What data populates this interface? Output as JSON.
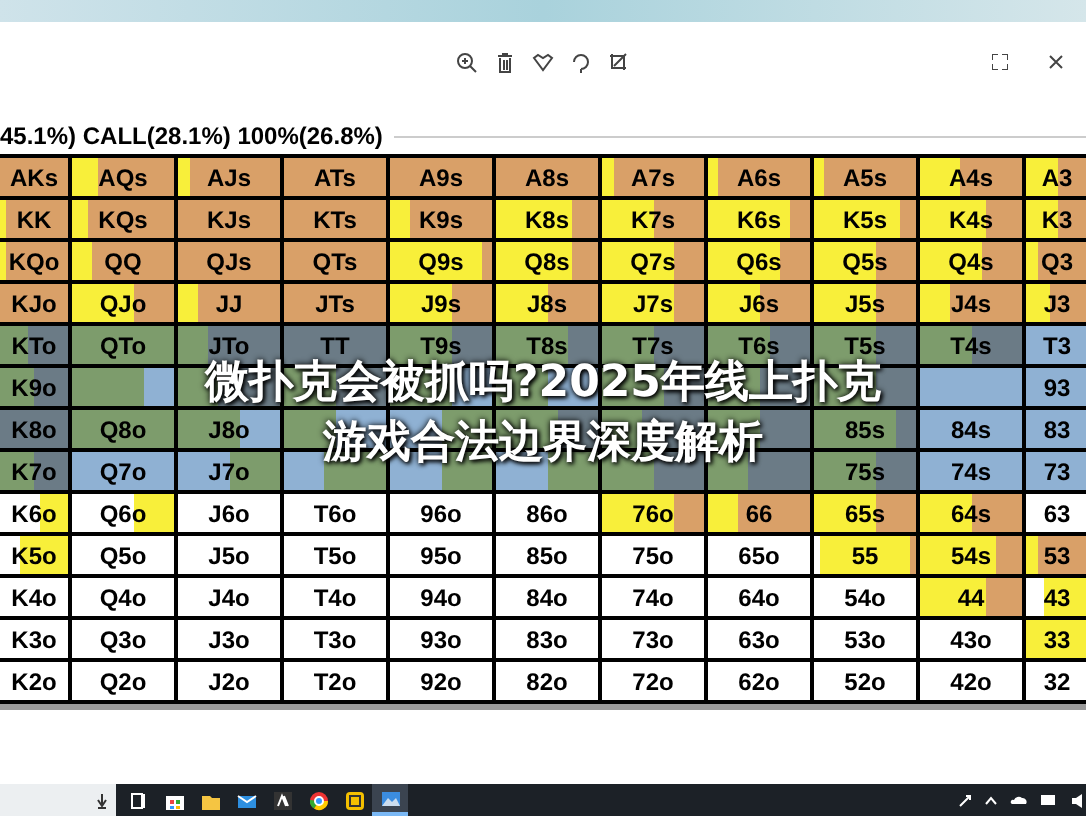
{
  "header": {
    "text": "45.1%) CALL(28.1%) 100%(26.8%)"
  },
  "banner": {
    "lines": [
      "微扑克会被抓吗?2025年线上扑克",
      "游戏合法边界深度解析"
    ]
  },
  "rows": [
    {
      "cells": [
        {
          "label": "AKs",
          "color": "#d9a068"
        },
        {
          "label": "AQs",
          "color": "#d9a068",
          "fills": [
            {
              "color": "#f8ef3a",
              "kind": "leading",
              "level": 0.25
            }
          ]
        },
        {
          "label": "AJs",
          "color": "#d9a068",
          "fills": [
            {
              "color": "#f8ef3a",
              "kind": "leading",
              "level": 0.12
            }
          ]
        },
        {
          "label": "ATs",
          "color": "#d9a068"
        },
        {
          "label": "A9s",
          "color": "#d9a068"
        },
        {
          "label": "A8s",
          "color": "#d9a068"
        },
        {
          "label": "A7s",
          "color": "#d9a068",
          "fills": [
            {
              "color": "#f8ef3a",
              "kind": "leading",
              "level": 0.12
            }
          ]
        },
        {
          "label": "A6s",
          "color": "#d9a068",
          "fills": [
            {
              "color": "#f8ef3a",
              "kind": "leading",
              "level": 0.1
            }
          ]
        },
        {
          "label": "A5s",
          "color": "#d9a068",
          "fills": [
            {
              "color": "#f8ef3a",
              "kind": "leading",
              "level": 0.1
            }
          ]
        },
        {
          "label": "A4s",
          "color": "#d9a068",
          "fills": [
            {
              "color": "#f8ef3a",
              "kind": "leading",
              "level": 0.4
            }
          ]
        },
        {
          "label": "A3",
          "color": "#d9a068",
          "fills": [
            {
              "color": "#f8ef3a",
              "kind": "leading",
              "level": 0.5
            }
          ]
        }
      ]
    },
    {
      "cells": [
        {
          "label": "KK",
          "color": "#d9a068",
          "fills": [
            {
              "color": "#f8ef3a",
              "kind": "leading",
              "level": 0.1
            }
          ]
        },
        {
          "label": "KQs",
          "color": "#d9a068",
          "fills": [
            {
              "color": "#f8ef3a",
              "kind": "leading",
              "level": 0.15
            }
          ]
        },
        {
          "label": "KJs",
          "color": "#d9a068"
        },
        {
          "label": "KTs",
          "color": "#d9a068"
        },
        {
          "label": "K9s",
          "color": "#d9a068",
          "fills": [
            {
              "color": "#f8ef3a",
              "kind": "leading",
              "level": 0.2
            }
          ]
        },
        {
          "label": "K8s",
          "color": "#d9a068",
          "fills": [
            {
              "color": "#f8ef3a",
              "kind": "leading",
              "level": 0.75
            }
          ]
        },
        {
          "label": "K7s",
          "color": "#d9a068",
          "fills": [
            {
              "color": "#f8ef3a",
              "kind": "leading",
              "level": 0.5
            }
          ]
        },
        {
          "label": "K6s",
          "color": "#d9a068",
          "fills": [
            {
              "color": "#f8ef3a",
              "kind": "leading",
              "level": 0.8
            }
          ]
        },
        {
          "label": "K5s",
          "color": "#d9a068",
          "fills": [
            {
              "color": "#f8ef3a",
              "kind": "leading",
              "level": 0.85
            }
          ]
        },
        {
          "label": "K4s",
          "color": "#d9a068",
          "fills": [
            {
              "color": "#f8ef3a",
              "kind": "leading",
              "level": 0.65
            }
          ]
        },
        {
          "label": "K3",
          "color": "#d9a068",
          "fills": [
            {
              "color": "#f8ef3a",
              "kind": "leading",
              "level": 0.5
            }
          ]
        }
      ]
    },
    {
      "cells": [
        {
          "label": "KQo",
          "color": "#d9a068",
          "fills": [
            {
              "color": "#f8ef3a",
              "kind": "leading",
              "level": 0.1
            }
          ]
        },
        {
          "label": "QQ",
          "color": "#d9a068",
          "fills": [
            {
              "color": "#f8ef3a",
              "kind": "leading",
              "level": 0.2
            }
          ]
        },
        {
          "label": "QJs",
          "color": "#d9a068"
        },
        {
          "label": "QTs",
          "color": "#d9a068"
        },
        {
          "label": "Q9s",
          "color": "#d9a068",
          "fills": [
            {
              "color": "#f8ef3a",
              "kind": "leading",
              "level": 0.9
            }
          ]
        },
        {
          "label": "Q8s",
          "color": "#d9a068",
          "fills": [
            {
              "color": "#f8ef3a",
              "kind": "leading",
              "level": 0.75
            }
          ]
        },
        {
          "label": "Q7s",
          "color": "#d9a068",
          "fills": [
            {
              "color": "#f8ef3a",
              "kind": "leading",
              "level": 0.7
            }
          ]
        },
        {
          "label": "Q6s",
          "color": "#d9a068",
          "fills": [
            {
              "color": "#f8ef3a",
              "kind": "leading",
              "level": 0.7
            }
          ]
        },
        {
          "label": "Q5s",
          "color": "#d9a068",
          "fills": [
            {
              "color": "#f8ef3a",
              "kind": "leading",
              "level": 0.6
            }
          ]
        },
        {
          "label": "Q4s",
          "color": "#d9a068",
          "fills": [
            {
              "color": "#f8ef3a",
              "kind": "leading",
              "level": 0.6
            }
          ]
        },
        {
          "label": "Q3",
          "color": "#d9a068",
          "fills": [
            {
              "color": "#f8ef3a",
              "kind": "leading",
              "level": 0.2
            }
          ]
        }
      ]
    },
    {
      "cells": [
        {
          "label": "KJo",
          "color": "#d9a068"
        },
        {
          "label": "QJo",
          "color": "#d9a068",
          "fills": [
            {
              "color": "#f8ef3a",
              "kind": "leading",
              "level": 0.6
            }
          ]
        },
        {
          "label": "JJ",
          "color": "#d9a068",
          "fills": [
            {
              "color": "#f8ef3a",
              "kind": "leading",
              "level": 0.2
            }
          ]
        },
        {
          "label": "JTs",
          "color": "#d9a068"
        },
        {
          "label": "J9s",
          "color": "#d9a068",
          "fills": [
            {
              "color": "#f8ef3a",
              "kind": "leading",
              "level": 0.6
            }
          ]
        },
        {
          "label": "J8s",
          "color": "#d9a068",
          "fills": [
            {
              "color": "#f8ef3a",
              "kind": "leading",
              "level": 0.5
            }
          ]
        },
        {
          "label": "J7s",
          "color": "#d9a068",
          "fills": [
            {
              "color": "#f8ef3a",
              "kind": "leading",
              "level": 0.7
            }
          ]
        },
        {
          "label": "J6s",
          "color": "#d9a068",
          "fills": [
            {
              "color": "#f8ef3a",
              "kind": "leading",
              "level": 0.5
            }
          ]
        },
        {
          "label": "J5s",
          "color": "#d9a068",
          "fills": [
            {
              "color": "#f8ef3a",
              "kind": "leading",
              "level": 0.6
            }
          ]
        },
        {
          "label": "J4s",
          "color": "#d9a068",
          "fills": [
            {
              "color": "#f8ef3a",
              "kind": "leading",
              "level": 0.3
            }
          ]
        },
        {
          "label": "J3",
          "color": "#d9a068",
          "fills": [
            {
              "color": "#f8ef3a",
              "kind": "leading",
              "level": 0.4
            }
          ]
        }
      ]
    },
    {
      "cells": [
        {
          "label": "KTo",
          "color": "#6b7b86",
          "fills": [
            {
              "color": "#7d9c6c",
              "kind": "leading",
              "level": 0.4
            }
          ]
        },
        {
          "label": "QTo",
          "color": "#7d9c6c"
        },
        {
          "label": "JTo",
          "color": "#6b7b86",
          "fills": [
            {
              "color": "#7d9c6c",
              "kind": "leading",
              "level": 0.3
            }
          ]
        },
        {
          "label": "TT",
          "color": "#6b7b86"
        },
        {
          "label": "T9s",
          "color": "#6b7b86",
          "fills": [
            {
              "color": "#7d9c6c",
              "kind": "leading",
              "level": 0.6
            }
          ]
        },
        {
          "label": "T8s",
          "color": "#6b7b86",
          "fills": [
            {
              "color": "#7d9c6c",
              "kind": "leading",
              "level": 0.7
            }
          ]
        },
        {
          "label": "T7s",
          "color": "#6b7b86",
          "fills": [
            {
              "color": "#7d9c6c",
              "kind": "leading",
              "level": 0.5
            }
          ]
        },
        {
          "label": "T6s",
          "color": "#6b7b86",
          "fills": [
            {
              "color": "#7d9c6c",
              "kind": "leading",
              "level": 0.6
            }
          ]
        },
        {
          "label": "T5s",
          "color": "#6b7b86",
          "fills": [
            {
              "color": "#7d9c6c",
              "kind": "leading",
              "level": 0.6
            }
          ]
        },
        {
          "label": "T4s",
          "color": "#6b7b86",
          "fills": [
            {
              "color": "#7d9c6c",
              "kind": "leading",
              "level": 0.5
            }
          ]
        },
        {
          "label": "T3",
          "color": "#8fb1d3"
        }
      ]
    },
    {
      "cells": [
        {
          "label": "K9o",
          "color": "#6b7b86",
          "fills": [
            {
              "color": "#7d9c6c",
              "kind": "leading",
              "level": 0.5
            }
          ]
        },
        {
          "color": "#8fb1d3",
          "fills": [
            {
              "color": "#7d9c6c",
              "kind": "leading",
              "level": 0.7
            }
          ]
        },
        {
          "color": "#6b7b86",
          "fills": [
            {
              "color": "#7d9c6c",
              "kind": "leading",
              "level": 0.4
            }
          ]
        },
        {
          "color": "#6b7b86",
          "fills": [
            {
              "color": "#7d9c6c",
              "kind": "leading",
              "level": 0.5
            }
          ]
        },
        {
          "color": "#8fb1d3",
          "fills": [
            {
              "color": "#7d9c6c",
              "kind": "leading",
              "level": 0.6
            }
          ]
        },
        {
          "color": "#8fb1d3",
          "fills": [
            {
              "color": "#7d9c6c",
              "kind": "leading",
              "level": 0.5
            }
          ]
        },
        {
          "color": "#6b7b86",
          "fills": [
            {
              "color": "#7d9c6c",
              "kind": "leading",
              "level": 0.6
            }
          ]
        },
        {
          "color": "#6b7b86",
          "fills": [
            {
              "color": "#7d9c6c",
              "kind": "leading",
              "level": 0.5
            }
          ]
        },
        {
          "color": "#6b7b86",
          "fills": [
            {
              "color": "#7d9c6c",
              "kind": "leading",
              "level": 0.6
            }
          ]
        },
        {
          "color": "#8fb1d3"
        },
        {
          "label": "93",
          "color": "#8fb1d3"
        }
      ]
    },
    {
      "cells": [
        {
          "label": "K8o",
          "color": "#6b7b86"
        },
        {
          "label": "Q8o",
          "color": "#7d9c6c"
        },
        {
          "label": "J8o",
          "color": "#8fb1d3",
          "fills": [
            {
              "color": "#7d9c6c",
              "kind": "leading",
              "level": 0.6
            }
          ]
        },
        {
          "color": "#8fb1d3",
          "fills": [
            {
              "color": "#7d9c6c",
              "kind": "leading",
              "level": 0.5
            }
          ]
        },
        {
          "color": "#8fb1d3",
          "fills": [
            {
              "color": "#7d9c6c",
              "kind": "trailing",
              "level": 0.5
            }
          ]
        },
        {
          "color": "#6b7b86",
          "fills": [
            {
              "color": "#7d9c6c",
              "kind": "leading",
              "level": 0.6
            }
          ]
        },
        {
          "color": "#6b7b86",
          "fills": [
            {
              "color": "#7d9c6c",
              "kind": "leading",
              "level": 0.4
            }
          ]
        },
        {
          "color": "#6b7b86",
          "fills": [
            {
              "color": "#7d9c6c",
              "kind": "leading",
              "level": 0.5
            }
          ]
        },
        {
          "label": "85s",
          "color": "#6b7b86",
          "fills": [
            {
              "color": "#7d9c6c",
              "kind": "leading",
              "level": 0.8
            }
          ]
        },
        {
          "label": "84s",
          "color": "#8fb1d3"
        },
        {
          "label": "83",
          "color": "#8fb1d3"
        }
      ]
    },
    {
      "cells": [
        {
          "label": "K7o",
          "color": "#6b7b86",
          "fills": [
            {
              "color": "#7d9c6c",
              "kind": "leading",
              "level": 0.5
            }
          ]
        },
        {
          "label": "Q7o",
          "color": "#8fb1d3"
        },
        {
          "label": "J7o",
          "color": "#8fb1d3",
          "fills": [
            {
              "color": "#7d9c6c",
              "kind": "trailing",
              "level": 0.5
            }
          ]
        },
        {
          "color": "#8fb1d3",
          "fills": [
            {
              "color": "#7d9c6c",
              "kind": "trailing",
              "level": 0.6
            }
          ]
        },
        {
          "color": "#8fb1d3",
          "fills": [
            {
              "color": "#7d9c6c",
              "kind": "trailing",
              "level": 0.5
            }
          ]
        },
        {
          "color": "#8fb1d3",
          "fills": [
            {
              "color": "#7d9c6c",
              "kind": "trailing",
              "level": 0.5
            }
          ]
        },
        {
          "color": "#6b7b86",
          "fills": [
            {
              "color": "#7d9c6c",
              "kind": "leading",
              "level": 0.5
            }
          ]
        },
        {
          "color": "#6b7b86",
          "fills": [
            {
              "color": "#7d9c6c",
              "kind": "leading",
              "level": 0.4
            }
          ]
        },
        {
          "label": "75s",
          "color": "#6b7b86",
          "fills": [
            {
              "color": "#7d9c6c",
              "kind": "leading",
              "level": 0.6
            }
          ]
        },
        {
          "label": "74s",
          "color": "#8fb1d3"
        },
        {
          "label": "73",
          "color": "#8fb1d3"
        }
      ]
    },
    {
      "cells": [
        {
          "label": "K6o",
          "color": "#ffffff",
          "fills": [
            {
              "color": "#f8ef3a",
              "kind": "trailing",
              "level": 0.4
            }
          ]
        },
        {
          "label": "Q6o",
          "color": "#ffffff",
          "fills": [
            {
              "color": "#f8ef3a",
              "kind": "trailing",
              "level": 0.4
            }
          ]
        },
        {
          "label": "J6o",
          "color": "#ffffff"
        },
        {
          "label": "T6o",
          "color": "#ffffff"
        },
        {
          "label": "96o",
          "color": "#ffffff"
        },
        {
          "label": "86o",
          "color": "#ffffff"
        },
        {
          "label": "76o",
          "color": "#d9a068",
          "fills": [
            {
              "color": "#f8ef3a",
              "kind": "leading",
              "level": 0.7
            }
          ]
        },
        {
          "label": "66",
          "color": "#d9a068",
          "fills": [
            {
              "color": "#f8ef3a",
              "kind": "leading",
              "level": 0.3
            }
          ]
        },
        {
          "label": "65s",
          "color": "#d9a068",
          "fills": [
            {
              "color": "#f8ef3a",
              "kind": "leading",
              "level": 0.6
            }
          ]
        },
        {
          "label": "64s",
          "color": "#d9a068",
          "fills": [
            {
              "color": "#f8ef3a",
              "kind": "leading",
              "level": 0.5
            }
          ]
        },
        {
          "label": "63",
          "color": "#ffffff"
        }
      ]
    },
    {
      "cells": [
        {
          "label": "K5o",
          "color": "#ffffff",
          "fills": [
            {
              "color": "#f8ef3a",
              "kind": "trailing",
              "level": 0.7
            }
          ]
        },
        {
          "label": "Q5o",
          "color": "#ffffff"
        },
        {
          "label": "J5o",
          "color": "#ffffff"
        },
        {
          "label": "T5o",
          "color": "#ffffff"
        },
        {
          "label": "95o",
          "color": "#ffffff"
        },
        {
          "label": "85o",
          "color": "#ffffff"
        },
        {
          "label": "75o",
          "color": "#ffffff"
        },
        {
          "label": "65o",
          "color": "#ffffff"
        },
        {
          "label": "55",
          "color": "#f8ef3a",
          "fills": [
            {
              "color": "#ffffff",
              "kind": "leading",
              "level": 0.05
            },
            {
              "color": "#d9a068",
              "kind": "trailing",
              "level": 0.05
            }
          ]
        },
        {
          "label": "54s",
          "color": "#d9a068",
          "fills": [
            {
              "color": "#f8ef3a",
              "kind": "leading",
              "level": 0.75
            }
          ]
        },
        {
          "label": "53",
          "color": "#d9a068",
          "fills": [
            {
              "color": "#f8ef3a",
              "kind": "leading",
              "level": 0.2
            }
          ]
        }
      ]
    },
    {
      "cells": [
        {
          "label": "K4o",
          "color": "#ffffff"
        },
        {
          "label": "Q4o",
          "color": "#ffffff"
        },
        {
          "label": "J4o",
          "color": "#ffffff"
        },
        {
          "label": "T4o",
          "color": "#ffffff"
        },
        {
          "label": "94o",
          "color": "#ffffff"
        },
        {
          "label": "84o",
          "color": "#ffffff"
        },
        {
          "label": "74o",
          "color": "#ffffff"
        },
        {
          "label": "64o",
          "color": "#ffffff"
        },
        {
          "label": "54o",
          "color": "#ffffff"
        },
        {
          "label": "44",
          "color": "#d9a068",
          "fills": [
            {
              "color": "#f8ef3a",
              "kind": "leading",
              "level": 0.65
            }
          ]
        },
        {
          "label": "43",
          "color": "#ffffff",
          "fills": [
            {
              "color": "#f8ef3a",
              "kind": "trailing",
              "level": 0.7
            }
          ]
        }
      ]
    },
    {
      "cells": [
        {
          "label": "K3o",
          "color": "#ffffff"
        },
        {
          "label": "Q3o",
          "color": "#ffffff"
        },
        {
          "label": "J3o",
          "color": "#ffffff"
        },
        {
          "label": "T3o",
          "color": "#ffffff"
        },
        {
          "label": "93o",
          "color": "#ffffff"
        },
        {
          "label": "83o",
          "color": "#ffffff"
        },
        {
          "label": "73o",
          "color": "#ffffff"
        },
        {
          "label": "63o",
          "color": "#ffffff"
        },
        {
          "label": "53o",
          "color": "#ffffff"
        },
        {
          "label": "43o",
          "color": "#ffffff"
        },
        {
          "label": "33",
          "color": "#f8ef3a"
        }
      ]
    },
    {
      "cells": [
        {
          "label": "K2o",
          "color": "#ffffff"
        },
        {
          "label": "Q2o",
          "color": "#ffffff"
        },
        {
          "label": "J2o",
          "color": "#ffffff"
        },
        {
          "label": "T2o",
          "color": "#ffffff"
        },
        {
          "label": "92o",
          "color": "#ffffff"
        },
        {
          "label": "82o",
          "color": "#ffffff"
        },
        {
          "label": "72o",
          "color": "#ffffff"
        },
        {
          "label": "62o",
          "color": "#ffffff"
        },
        {
          "label": "52o",
          "color": "#ffffff"
        },
        {
          "label": "42o",
          "color": "#ffffff"
        },
        {
          "label": "32",
          "color": "#ffffff"
        }
      ]
    }
  ],
  "taskbar": {
    "apps": [
      {
        "selected": false
      },
      {
        "selected": false
      },
      {
        "selected": false
      },
      {
        "selected": false
      },
      {
        "selected": false
      },
      {
        "selected": false
      },
      {
        "selected": false
      },
      {
        "selected": true
      }
    ]
  }
}
